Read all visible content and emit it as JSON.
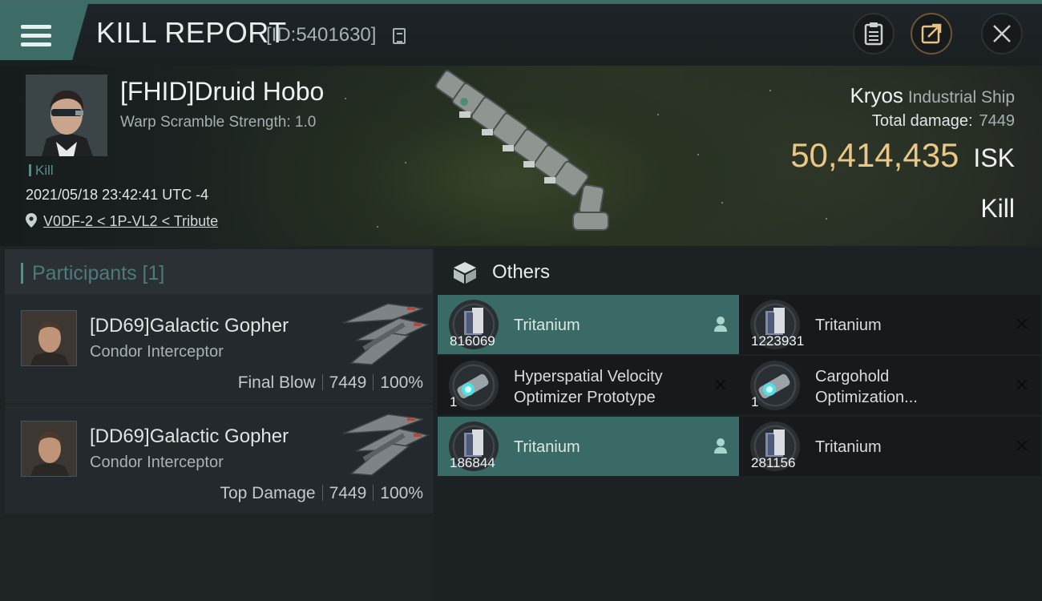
{
  "header": {
    "title": "KILL REPORT",
    "report_id": "[ID:5401630]"
  },
  "victim": {
    "name": "[FHID]Druid Hobo",
    "warp_scramble": "Warp Scramble Strength: 1.0",
    "result_tag": "Kill",
    "datetime": "2021/05/18 23:42:41 UTC -4",
    "location": "V0DF-2 < 1P-VL2 < Tribute"
  },
  "ship": {
    "name": "Kryos",
    "class": "Industrial Ship",
    "total_damage_label": "Total damage:",
    "total_damage": "7449",
    "isk_value": "50,414,435",
    "isk_unit": "ISK",
    "result": "Kill"
  },
  "participants": {
    "title": "Participants [1]",
    "rows": [
      {
        "name": "[DD69]Galactic Gopher",
        "ship": "Condor Interceptor",
        "role": "Final Blow",
        "damage": "7449",
        "percent": "100%"
      },
      {
        "name": "[DD69]Galactic Gopher",
        "ship": "Condor Interceptor",
        "role": "Top Damage",
        "damage": "7449",
        "percent": "100%"
      }
    ]
  },
  "others": {
    "title": "Others",
    "items": [
      {
        "name": "Tritanium",
        "qty": "816069",
        "status": "dropped",
        "icon": "tritanium-icon"
      },
      {
        "name": "Tritanium",
        "qty": "1223931",
        "status": "destroyed",
        "icon": "tritanium-icon"
      },
      {
        "name_line1": "Hyperspatial Velocity",
        "name_line2": "Optimizer Prototype",
        "qty": "1",
        "status": "destroyed",
        "icon": "rig-icon"
      },
      {
        "name_line1": "Cargohold",
        "name_line2": "Optimization...",
        "qty": "1",
        "status": "destroyed",
        "icon": "rig-icon"
      },
      {
        "name": "Tritanium",
        "qty": "186844",
        "status": "dropped",
        "icon": "tritanium-icon"
      },
      {
        "name": "Tritanium",
        "qty": "281156",
        "status": "destroyed",
        "icon": "tritanium-icon"
      }
    ]
  },
  "colors": {
    "accent_teal": "#3a6a65",
    "isk_gold": "#e9c786",
    "background": "#1b1f23"
  }
}
